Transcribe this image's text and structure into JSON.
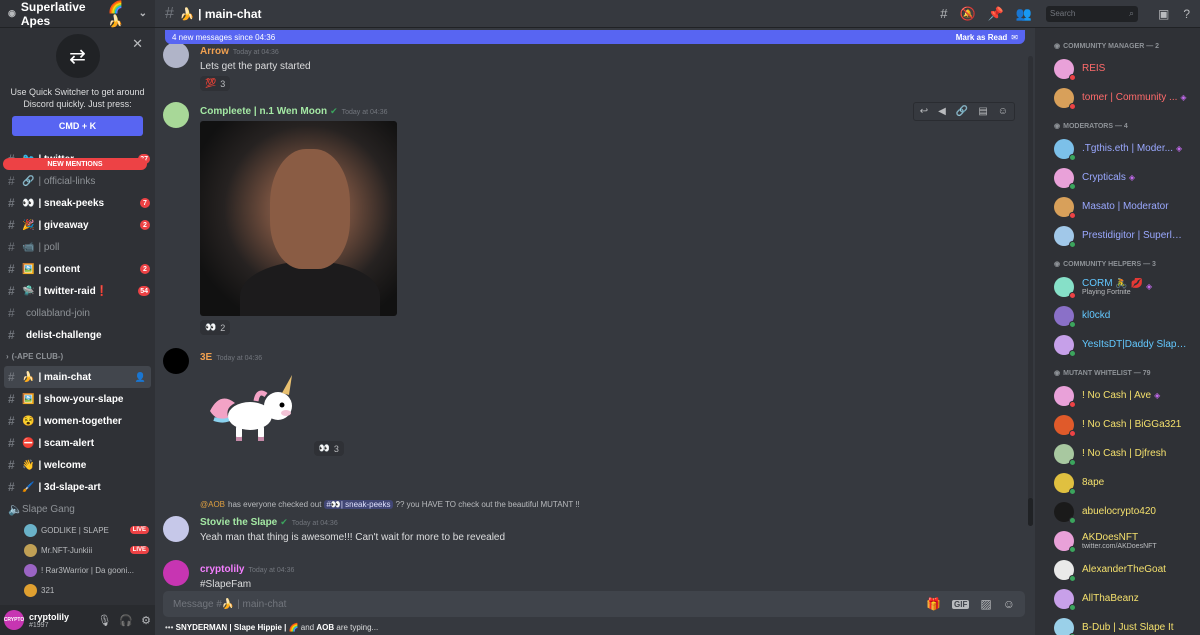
{
  "server": {
    "name": "Superlative Apes",
    "emoji": "🌈🍌"
  },
  "switcher": {
    "text": "Use Quick Switcher to get around Discord quickly. Just press:",
    "button": "CMD + K"
  },
  "channels": {
    "new_mentions": "NEW MENTIONS",
    "items": [
      {
        "emoji": "🐦",
        "name": "| twitter",
        "badge": "37",
        "unread": true
      },
      {
        "emoji": "🔗",
        "name": "| official-links",
        "badge": "",
        "unread": false
      },
      {
        "emoji": "👀",
        "name": "| sneak-peeks",
        "badge": "7",
        "unread": true
      },
      {
        "emoji": "🎉",
        "name": "| giveaway",
        "badge": "2",
        "unread": true
      },
      {
        "emoji": "📹",
        "name": "| poll",
        "badge": "",
        "unread": false
      },
      {
        "emoji": "🖼️",
        "name": "| content",
        "badge": "2",
        "unread": true
      },
      {
        "emoji": "🛸",
        "name": "| twitter-raid❗",
        "badge": "54",
        "unread": true
      },
      {
        "emoji": "",
        "name": "collabland-join",
        "badge": "",
        "unread": false
      },
      {
        "emoji": "",
        "name": "delist-challenge",
        "badge": "",
        "unread": true
      }
    ],
    "category": "(-APE CLUB-)",
    "club": [
      {
        "emoji": "🍌",
        "name": "| main-chat",
        "active": true
      },
      {
        "emoji": "🖼️",
        "name": "| show-your-slape"
      },
      {
        "emoji": "😵",
        "name": "| women-together"
      },
      {
        "emoji": "⛔",
        "name": "| scam-alert"
      },
      {
        "emoji": "👋",
        "name": "| welcome"
      },
      {
        "emoji": "🖌️",
        "name": "| 3d-slape-art"
      }
    ],
    "voice": {
      "name": "Slape Gang",
      "users": [
        {
          "name": "GODLIKE | SLAPE",
          "live": "LIVE",
          "color": "#6ab2c9"
        },
        {
          "name": "Mr.NFT-Junkiii",
          "live": "LIVE",
          "color": "#c0a055"
        },
        {
          "name": "! Rar3Warrior | Da gooni...",
          "live": "",
          "color": "#9b64c4"
        },
        {
          "name": "321",
          "live": "",
          "color": "#e0a030"
        }
      ]
    }
  },
  "user": {
    "name": "cryptolily",
    "tag": "#1997",
    "avatar_text": "CRYPTO"
  },
  "topbar": {
    "channel": "🍌 | main-chat",
    "search_placeholder": "Search"
  },
  "banner": {
    "text": "4 new messages since 04:36",
    "action": "Mark as Read"
  },
  "messages": [
    {
      "name": "Arrow",
      "time": "Today at 04:36",
      "text": "Lets get the party started",
      "reaction": "💯",
      "count": "3",
      "color": "#f0a050"
    },
    {
      "name": "Compleete | n.1 Wen Moon",
      "time": "Today at 04:36",
      "reaction": "👀",
      "count": "2",
      "color": "#a4e8a4"
    },
    {
      "name": "3E",
      "time": "Today at 04:36",
      "reaction": "👀",
      "count": "3",
      "color": "#f0a050"
    },
    {
      "reply_user": "@AOB",
      "reply_text": "has everyone checked out",
      "reply_channel": "#👀| sneak-peeks",
      "reply_tail": "?? you HAVE TO check out the beautiful MUTANT !!",
      "name": "Stovie the Slape",
      "time": "Today at 04:36",
      "text": "Yeah man that thing is awesome!!! Can't wait for more to be revealed",
      "color": "#a4e8a4"
    },
    {
      "name": "cryptolily",
      "time": "Today at 04:36",
      "text": "#SlapeFam",
      "color": "#f47fff"
    }
  ],
  "composer": {
    "placeholder": "Message #🍌 | main-chat",
    "gif": "GIF"
  },
  "typing": {
    "users": "SNYDERMAN | Slape Hippie | 🌈",
    "and": "and",
    "last": "AOB",
    "suffix": "are typing..."
  },
  "members": {
    "groups": [
      {
        "role": "COMMUNITY MANAGER — 2",
        "items": [
          {
            "name": "REIS",
            "color": "#ff6b6b",
            "av": "#e9a1d9",
            "status": "#ed4245"
          },
          {
            "name": "tomer | Community ...",
            "color": "#ff6b6b",
            "av": "#d8a05a",
            "status": "#ed4245",
            "gem": true
          }
        ]
      },
      {
        "role": "MODERATORS — 4",
        "items": [
          {
            "name": ".Tgthis.eth | Moder...",
            "color": "#9aa8ff",
            "av": "#7cc0e9",
            "status": "#3ba55d",
            "gem": true
          },
          {
            "name": "Crypticals",
            "color": "#9aa8ff",
            "av": "#e9a1d9",
            "status": "#3ba55d",
            "gem": true
          },
          {
            "name": "Masato | Moderator",
            "color": "#9aa8ff",
            "av": "#d8a05a",
            "status": "#ed4245"
          },
          {
            "name": "Prestidigitor | Superlat...",
            "color": "#9aa8ff",
            "av": "#a1c8e9",
            "status": "#3ba55d"
          }
        ]
      },
      {
        "role": "COMMUNITY HELPERS — 3",
        "items": [
          {
            "name": "CORM 🚴 💋",
            "sub": "Playing Fortnite",
            "color": "#63c8ff",
            "av": "#86e0c8",
            "status": "#ed4245",
            "gem": true
          },
          {
            "name": "kl0ckd",
            "color": "#63c8ff",
            "av": "#8a70c8",
            "status": "#3ba55d"
          },
          {
            "name": "YesItsDT|Daddy Slape...",
            "color": "#63c8ff",
            "av": "#c6a0e9",
            "status": "#3ba55d"
          }
        ]
      },
      {
        "role": "MUTANT WHITELIST — 79",
        "items": [
          {
            "name": "! No Cash | Ave",
            "color": "#f4e06d",
            "av": "#e9a1d9",
            "status": "#ed4245",
            "gem": true
          },
          {
            "name": "! No Cash | BiGGa321",
            "color": "#f4e06d",
            "av": "#e05a2a",
            "status": "#ed4245"
          },
          {
            "name": "! No Cash | Djfresh",
            "color": "#f4e06d",
            "av": "#a8c8a0",
            "status": "#3ba55d"
          },
          {
            "name": "8ape",
            "color": "#f4e06d",
            "av": "#e0c040",
            "status": "#3ba55d"
          },
          {
            "name": "abuelocrypto420",
            "color": "#f4e06d",
            "av": "#1a1a1a",
            "status": "#3ba55d"
          },
          {
            "name": "AKDoesNFT",
            "sub": "twitter.com/AKDoesNFT",
            "color": "#f4e06d",
            "av": "#e9a1d9",
            "status": "#3ba55d"
          },
          {
            "name": "AlexanderTheGoat",
            "color": "#f4e06d",
            "av": "#e9e9e9",
            "status": "#3ba55d"
          },
          {
            "name": "AllThaBeanz",
            "color": "#f4e06d",
            "av": "#c8a0e9",
            "status": "#3ba55d"
          },
          {
            "name": "B-Dub | Just Slape It",
            "color": "#f4e06d",
            "av": "#9ad0e9",
            "status": "#3ba55d"
          }
        ]
      }
    ]
  }
}
